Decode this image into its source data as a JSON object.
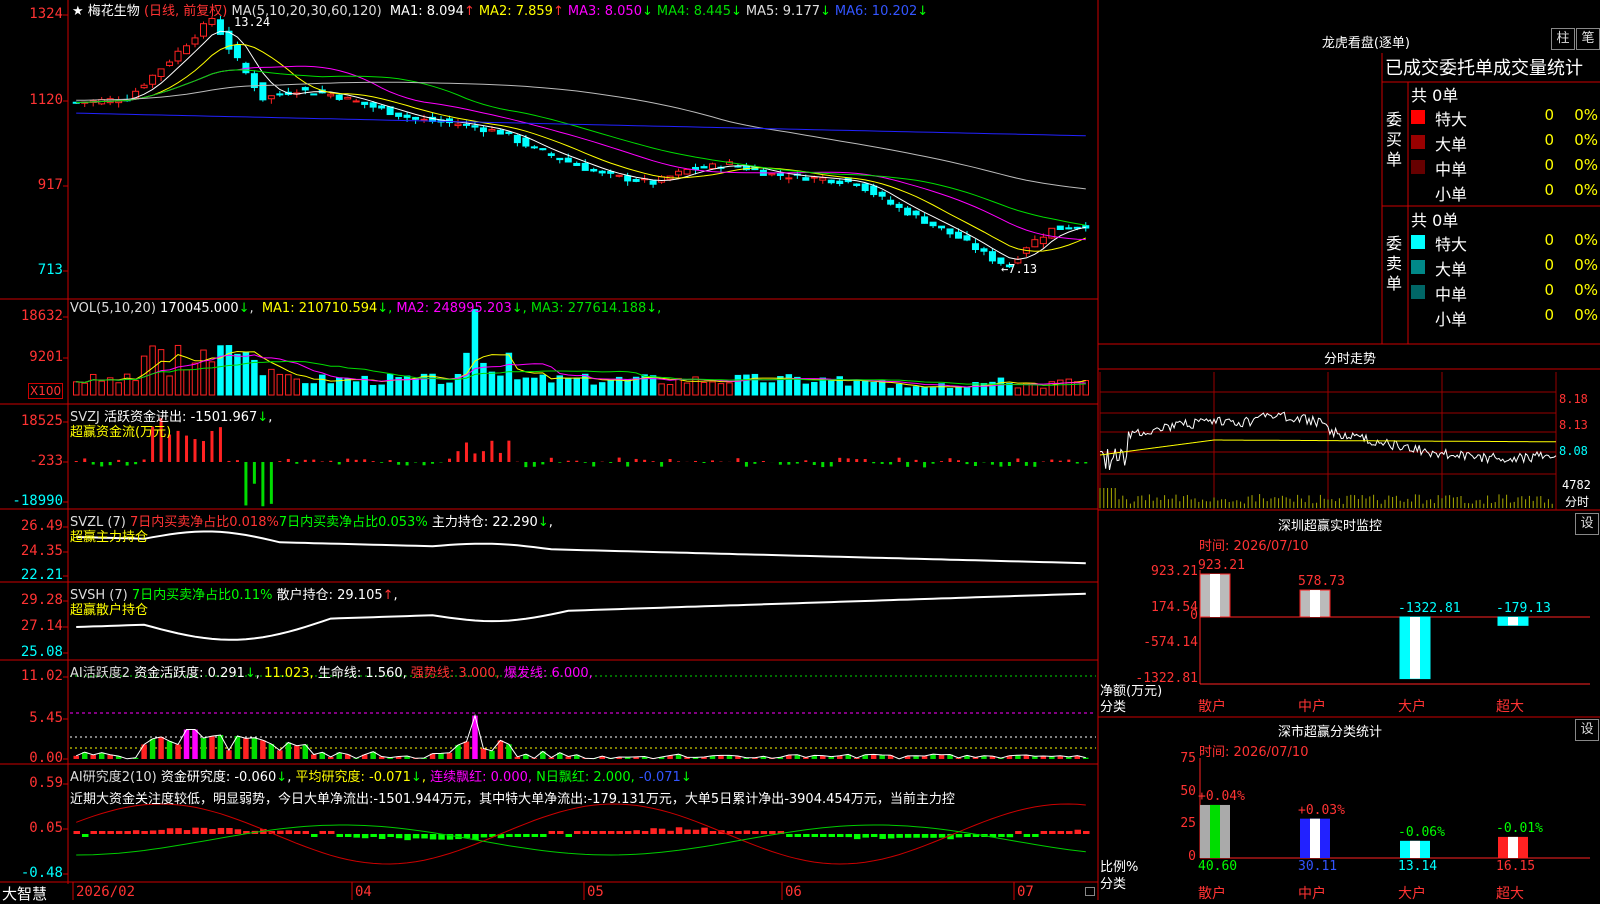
{
  "colors": {
    "up": "#ff2222",
    "down": "#00ffff",
    "frame": "#cc0000",
    "white": "#ffffff",
    "yellow": "#ffff00",
    "magenta": "#ff00ff",
    "green": "#00dd00",
    "blue": "#2222ff",
    "gray": "#aaaaaa"
  },
  "main": {
    "star": "★",
    "stock_name": "梅花生物",
    "period_label": "(日线, 前复权)",
    "ma_params": "MA(5,10,20,30,60,120)",
    "ma": [
      {
        "label": "MA1:",
        "value": "8.094",
        "arrow": "↑"
      },
      {
        "label": "MA2:",
        "value": "7.859",
        "arrow": "↑"
      },
      {
        "label": "MA3:",
        "value": "8.050",
        "arrow": "↓"
      },
      {
        "label": "MA4:",
        "value": "8.445",
        "arrow": "↓"
      },
      {
        "label": "MA5:",
        "value": "9.177",
        "arrow": "↓"
      },
      {
        "label": "MA6:",
        "value": "10.202",
        "arrow": "↓"
      }
    ],
    "high_label": "13.24",
    "low_label": "←7.13",
    "yticks": [
      "1324",
      "1120",
      "917",
      "713"
    ]
  },
  "vol": {
    "title": "VOL(5,10,20)",
    "value": "170045.000",
    "arrow": "↓",
    "ma": [
      {
        "label": "MA1:",
        "value": "210710.594",
        "arrow": "↓"
      },
      {
        "label": "MA2:",
        "value": "248995.203",
        "arrow": "↓"
      },
      {
        "label": "MA3:",
        "value": "277614.188",
        "arrow": "↓"
      }
    ],
    "yticks": [
      "18632",
      "9201"
    ],
    "unit": "X100"
  },
  "svzj": {
    "title": "SVZJ",
    "line1_label": "活跃资金进出:",
    "line1_value": "-1501.967",
    "arrow": "↓",
    "tail": ",",
    "line2": "超赢资金流(万元)",
    "yticks": [
      "18525",
      "-233",
      "-18990"
    ]
  },
  "svzl": {
    "title": "SVZL (7)",
    "t1": "7日内买卖净占比0.018%",
    "t2": "7日内买卖净占比0.053%",
    "t3": "主力持仓:",
    "value": "22.290",
    "arrow": "↓",
    "tail": ",",
    "line2": "超赢主力持仓",
    "yticks": [
      "26.49",
      "24.35",
      "22.21"
    ]
  },
  "svsh": {
    "title": "SVSH (7)",
    "t1": "7日内买卖净占比0.11%",
    "t2": "散户持仓:",
    "value": "29.105",
    "arrow": "↑",
    "tail": ",",
    "line2": "超赢散户持仓",
    "yticks": [
      "29.28",
      "27.14",
      "25.08"
    ]
  },
  "ai1": {
    "title": "AI活跃度2",
    "l1": "资金活跃度:",
    "v1": "0.291",
    "a1": "↓",
    "tail1": ",",
    "v2": "11.023",
    "tail2": ",",
    "l3": "生命线:",
    "v3": "1.560",
    "tail3": ",",
    "l4": "强势线:",
    "v4": "3.000",
    "tail4": ",",
    "l5": "爆发线:",
    "v5": "6.000",
    "tail5": ",",
    "yticks": [
      "11.02",
      "5.45",
      "0.00"
    ]
  },
  "ai2": {
    "title": "AI研究度2(10)",
    "l1": "资金研究度:",
    "v1": "-0.060",
    "a1": "↓",
    "tail1": ",",
    "l2": "平均研究度:",
    "v2": "-0.071",
    "a2": "↓",
    "tail2": ",",
    "l3": "连续飘红:",
    "v3": "0.000",
    "tail3": ",",
    "l4": "N日飘红:",
    "v4": "2.000",
    "tail4": ",",
    "v5": "-0.071",
    "a5": "↓",
    "comment": "近期大资金关注度较低，明显弱势，今日大单净流出:-1501.944万元，其中特大单净流出:-179.131万元，大单5日累计净出-3904.454万元，当前主力控",
    "yticks": [
      "0.59",
      "0.05",
      "-0.48"
    ]
  },
  "bottom": {
    "logo": "大智慧",
    "dates": [
      "2026/02",
      "04",
      "05",
      "06",
      "07"
    ]
  },
  "lhb": {
    "title": "龙虎看盘(逐单)",
    "btn1": "柱",
    "btn2": "笔",
    "header": "已成交委托单成交量统计",
    "buy_label": "委买单",
    "sell_label": "委卖单",
    "buy_total": "共 0单",
    "sell_total": "共 0单",
    "buy_rows": [
      {
        "name": "特大",
        "n": "0",
        "p": "0%",
        "color": "#ff0000"
      },
      {
        "name": "大单",
        "n": "0",
        "p": "0%",
        "color": "#990000"
      },
      {
        "name": "中单",
        "n": "0",
        "p": "0%",
        "color": "#660000"
      },
      {
        "name": "小单",
        "n": "0",
        "p": "0%",
        "color": ""
      }
    ],
    "sell_rows": [
      {
        "name": "特大",
        "n": "0",
        "p": "0%",
        "color": "#00ffff"
      },
      {
        "name": "大单",
        "n": "0",
        "p": "0%",
        "color": "#008888"
      },
      {
        "name": "中单",
        "n": "0",
        "p": "0%",
        "color": "#006666"
      },
      {
        "name": "小单",
        "n": "0",
        "p": "0%",
        "color": ""
      }
    ]
  },
  "intraday": {
    "title": "分时走势",
    "yticks": [
      "8.18",
      "8.13",
      "8.08"
    ],
    "vol_label": "4782",
    "vol_unit": "分时"
  },
  "sz_monitor": {
    "title": "深圳超赢实时监控",
    "btn": "设",
    "time_label": "时间:",
    "time_value": "2026/07/10",
    "yticks": [
      "923.21",
      "174.54",
      "0",
      "-574.14",
      "-1322.81"
    ],
    "ylabel": "净额(万元)",
    "xlabel": "分类"
  },
  "sz_stats": {
    "title": "深市超赢分类统计",
    "btn": "设",
    "time_label": "时间:",
    "time_value": "2026/07/10",
    "yticks": [
      "75",
      "50",
      "25",
      "0"
    ],
    "ylabel": "比例%",
    "xlabel": "分类"
  },
  "chart_data": [
    {
      "type": "bar",
      "title": "深圳超赢实时监控",
      "categories": [
        "散户",
        "中户",
        "大户",
        "超大"
      ],
      "values": [
        923.21,
        578.73,
        -1322.81,
        -179.13
      ],
      "ylabel": "净额(万元)",
      "xlabel": "分类",
      "ylim": [
        -1322.81,
        923.21
      ]
    },
    {
      "type": "bar",
      "title": "深市超赢分类统计",
      "categories": [
        "散户",
        "中户",
        "大户",
        "超大"
      ],
      "values": [
        40.6,
        30.11,
        13.14,
        16.15
      ],
      "changes": [
        "+0.04%",
        "+0.03%",
        "-0.06%",
        "-0.01%"
      ],
      "ylabel": "比例%",
      "xlabel": "分类",
      "ylim": [
        0,
        75
      ]
    }
  ]
}
